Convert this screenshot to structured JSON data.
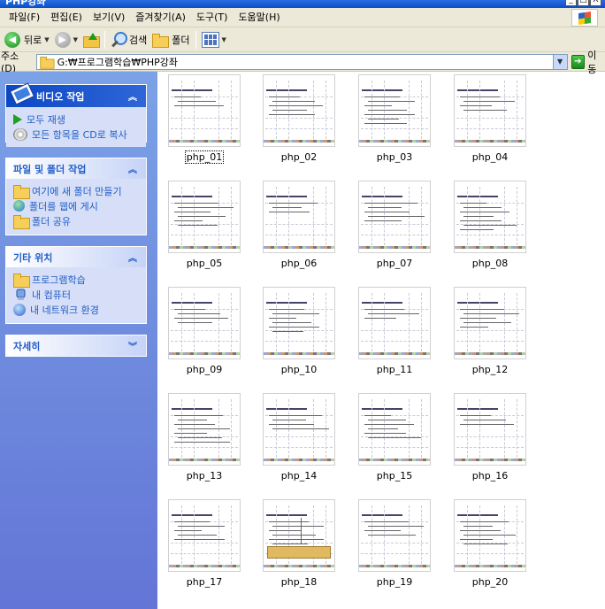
{
  "window": {
    "title": "PHP강좌",
    "controls": [
      "_",
      "□",
      "X"
    ]
  },
  "menu": [
    "파일(F)",
    "편집(E)",
    "보기(V)",
    "즐겨찾기(A)",
    "도구(T)",
    "도움말(H)"
  ],
  "toolbar": {
    "back": "뒤로",
    "search": "검색",
    "folders": "폴더"
  },
  "address": {
    "label": "주소(D)",
    "path": "G:₩프로그램학습₩PHP강좌",
    "go": "이동"
  },
  "tasks": {
    "media": {
      "title": "비디오 작업",
      "items": [
        "모두 재생",
        "모든 항목을 CD로 복사"
      ]
    },
    "file": {
      "title": "파일 및 폴더 작업",
      "items": [
        "여기에 새 폴더 만들기",
        "폴더를 웹에 게시",
        "폴더 공유"
      ]
    },
    "other": {
      "title": "기타 위치",
      "items": [
        "프로그램학습",
        "내 컴퓨터",
        "내 네트워크 환경"
      ]
    },
    "details": {
      "title": "자세히"
    }
  },
  "files": [
    "php_01",
    "php_02",
    "php_03",
    "php_04",
    "php_05",
    "php_06",
    "php_07",
    "php_08",
    "php_09",
    "php_10",
    "php_11",
    "php_12",
    "php_13",
    "php_14",
    "php_15",
    "php_16",
    "php_17",
    "php_18",
    "php_19",
    "php_20"
  ],
  "selected_file": "php_01"
}
